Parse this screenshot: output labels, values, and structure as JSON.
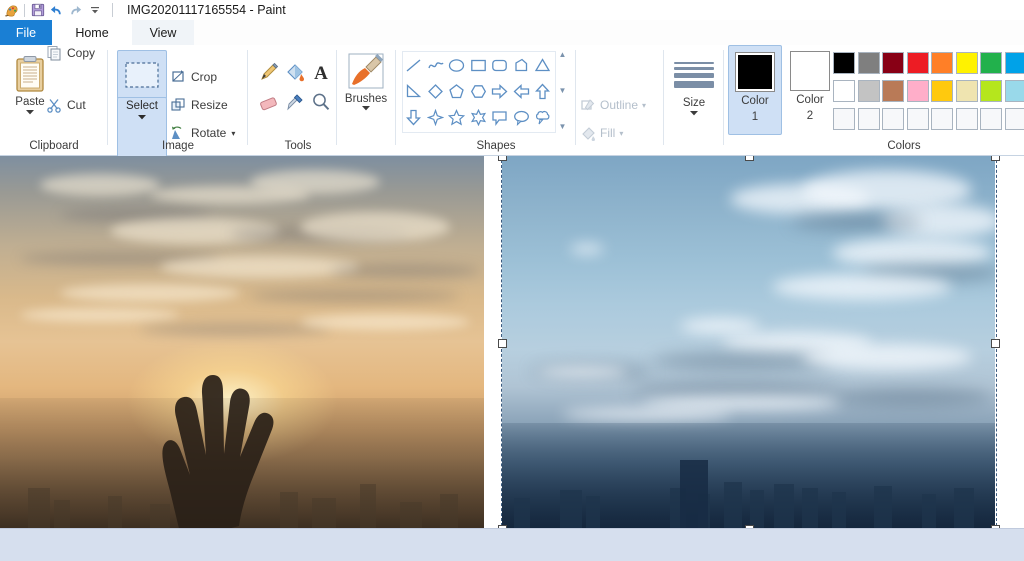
{
  "window": {
    "title": "IMG20201117165554 - Paint",
    "quick_access": [
      {
        "name": "paint-icon",
        "glyph": "paint"
      },
      {
        "name": "save-icon",
        "glyph": "save"
      },
      {
        "name": "undo-icon",
        "glyph": "undo"
      },
      {
        "name": "redo-icon",
        "glyph": "redo"
      },
      {
        "name": "customize-qat-icon",
        "glyph": "caret-down"
      }
    ]
  },
  "tabs": [
    {
      "label": "File",
      "active": false
    },
    {
      "label": "Home",
      "active": true
    },
    {
      "label": "View",
      "active": false
    }
  ],
  "ribbon": {
    "clipboard": {
      "label": "Clipboard",
      "paste": "Paste",
      "cut": "Cut",
      "copy": "Copy"
    },
    "image": {
      "label": "Image",
      "select": "Select",
      "crop": "Crop",
      "resize": "Resize",
      "rotate": "Rotate"
    },
    "tools": {
      "label": "Tools",
      "items": [
        {
          "name": "pencil-icon"
        },
        {
          "name": "fill-with-color-icon"
        },
        {
          "name": "text-icon"
        },
        {
          "name": "eraser-icon"
        },
        {
          "name": "color-picker-icon"
        },
        {
          "name": "magnifier-icon"
        }
      ]
    },
    "brushes": {
      "label": "Brushes"
    },
    "shapes": {
      "label": "Shapes",
      "items": [
        "line",
        "curve",
        "oval",
        "rectangle",
        "rounded-rectangle",
        "polygon",
        "triangle",
        "right-triangle",
        "diamond",
        "pentagon",
        "hexagon",
        "right-arrow",
        "left-arrow",
        "up-arrow",
        "down-arrow",
        "four-point-star",
        "five-point-star",
        "six-point-star",
        "rounded-callout",
        "oval-callout",
        "cloud-callout"
      ]
    },
    "outline_fill": {
      "outline": "Outline",
      "fill": "Fill",
      "disabled": true
    },
    "size": {
      "label": "Size"
    },
    "colors": {
      "label": "Colors",
      "color1_caption": "Color",
      "color1_number": "1",
      "color2_caption": "Color",
      "color2_number": "2",
      "color1_value": "#000000",
      "color2_value": "#ffffff",
      "palette_row1": [
        "#000000",
        "#7f7f7f",
        "#880015",
        "#ed1c24",
        "#ff7f27",
        "#fff200",
        "#22b14c",
        "#00a2e8"
      ],
      "palette_row2": [
        "#ffffff",
        "#c3c3c3",
        "#b97a57",
        "#ffaec9",
        "#ffc90e",
        "#efe4b0",
        "#b5e61d",
        "#99d9ea"
      ],
      "palette_row3": [
        "#f7f8fa",
        "#f7f8fa",
        "#f7f8fa",
        "#f7f8fa",
        "#f7f8fa",
        "#f7f8fa",
        "#f7f8fa",
        "#f7f8fa"
      ]
    }
  },
  "canvas": {
    "left_image": {
      "name": "sunset-hand-photo",
      "description": "Hand silhouette reaching toward the sun over a hazy city skyline at sunset"
    },
    "right_image": {
      "name": "blue-sky-city-photo",
      "description": "Blue sky with clouds over a hazy city skyline, currently selected"
    },
    "selection": {
      "active": true,
      "handles": [
        "top-left",
        "top-middle",
        "top-right",
        "middle-left",
        "middle-right",
        "bottom-left",
        "bottom-middle",
        "bottom-right"
      ]
    }
  },
  "statusbar": {
    "text": ""
  }
}
